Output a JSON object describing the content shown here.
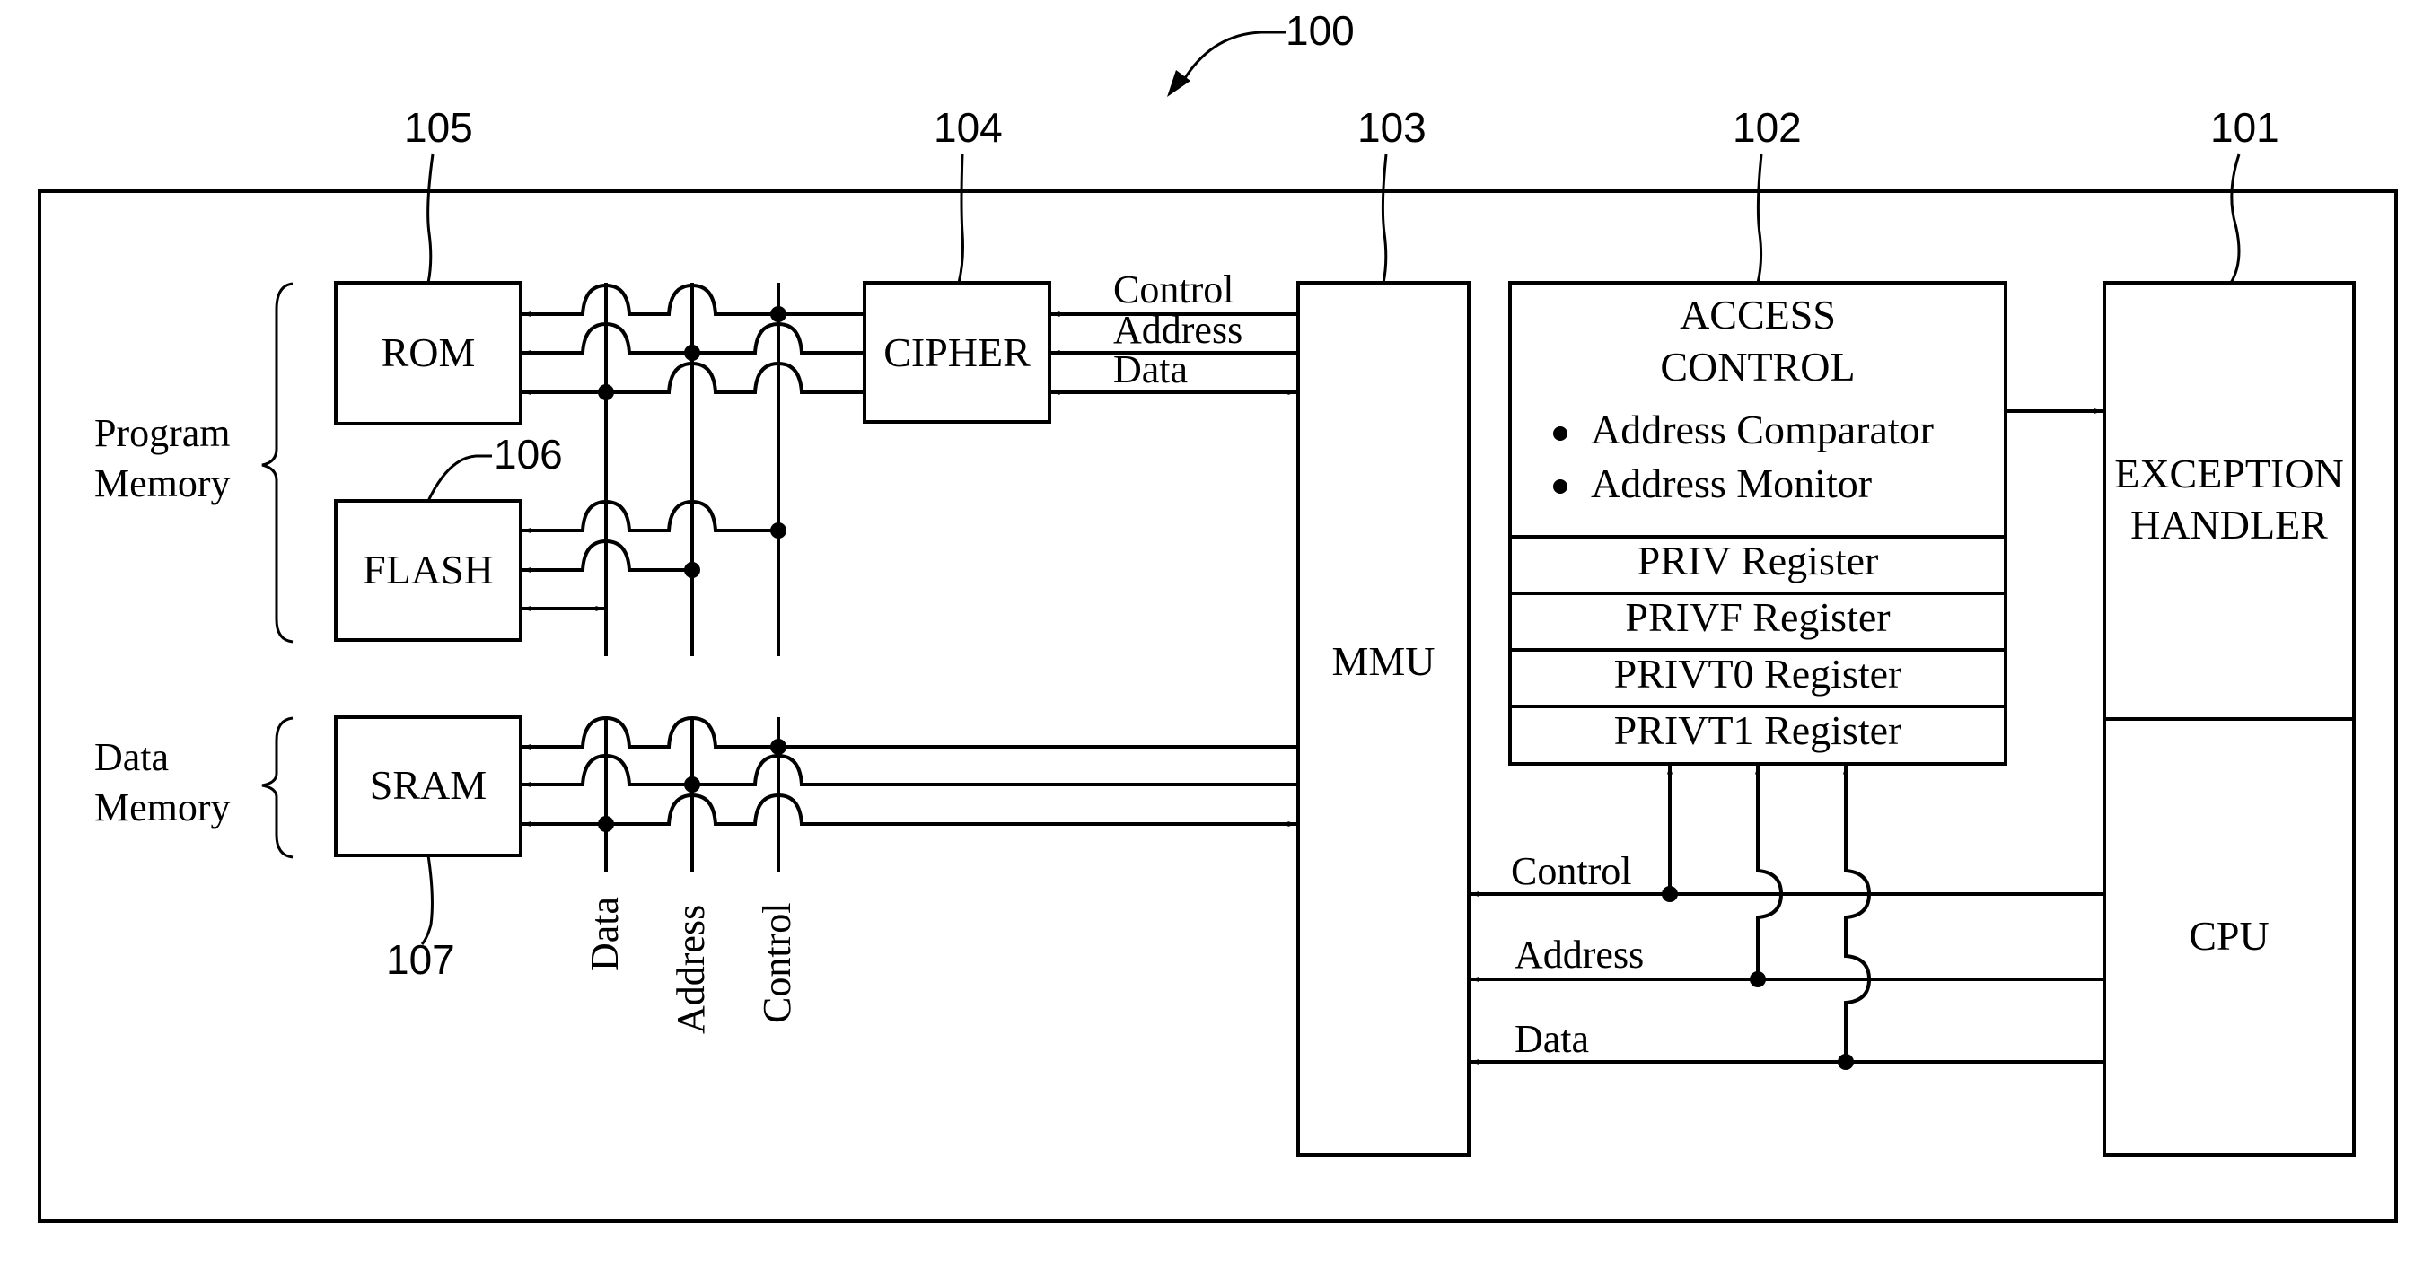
{
  "figure": {
    "ref_system": "100",
    "refs": {
      "cpu": "101",
      "access_control": "102",
      "mmu": "103",
      "cipher": "104",
      "rom": "105",
      "flash": "106",
      "sram": "107"
    },
    "groups": {
      "program_memory": [
        "Program",
        "Memory"
      ],
      "data_memory": [
        "Data",
        "Memory"
      ]
    },
    "blocks": {
      "rom": "ROM",
      "flash": "FLASH",
      "sram": "SRAM",
      "cipher": "CIPHER",
      "mmu": "MMU",
      "access_control_title": [
        "ACCESS",
        "CONTROL"
      ],
      "access_control_bullets": [
        "Address Comparator",
        "Address Monitor"
      ],
      "registers": [
        "PRIV Register",
        "PRIVF Register",
        "PRIVT0 Register",
        "PRIVT1 Register"
      ],
      "exception_handler": [
        "EXCEPTION",
        "HANDLER"
      ],
      "cpu": "CPU"
    },
    "bus_labels": {
      "vertical": [
        "Data",
        "Address",
        "Control"
      ],
      "cipher_mmu": [
        "Control",
        "Address",
        "Data"
      ],
      "cpu_mmu": [
        "Control",
        "Address",
        "Data"
      ]
    }
  }
}
